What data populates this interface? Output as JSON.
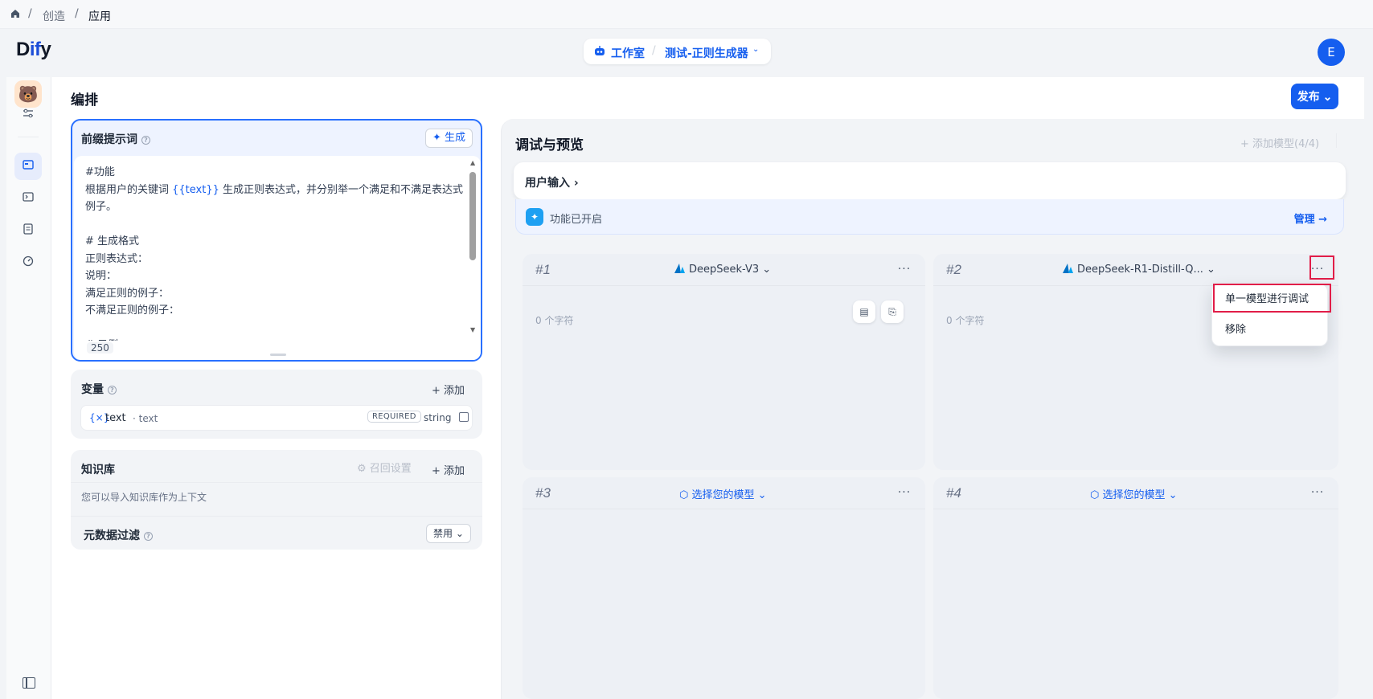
{
  "breadcrumb": {
    "items": [
      "创造",
      "应用"
    ],
    "separator": "/"
  },
  "header": {
    "logo": "Dify",
    "studio_label": "工作室",
    "app_name": "测试-正则生成器",
    "avatar_letter": "E",
    "brand_color": "#155eef"
  },
  "editor": {
    "title": "编排",
    "publish_label": "发布",
    "prompt": {
      "title": "前缀提示词",
      "generate_label": "生成",
      "lines": [
        [
          "#功能"
        ],
        [
          "根据用户的关键词 ",
          "{{text}}",
          " 生成正则表达式，并分别举一个满足和不满足表达式的"
        ],
        [
          "例子。"
        ],
        [
          ""
        ],
        [
          "# 生成格式"
        ],
        [
          "正则表达式："
        ],
        [
          "说明："
        ],
        [
          "满足正则的例子："
        ],
        [
          "不满足正则的例子："
        ],
        [
          ""
        ],
        [
          "# 示例"
        ]
      ],
      "char_count": "250"
    },
    "variables": {
      "title": "变量",
      "add_label": "添加",
      "items": [
        {
          "name": "text",
          "key": "· text",
          "required": "REQUIRED",
          "type": "string"
        }
      ]
    },
    "knowledge": {
      "title": "知识库",
      "recall_label": "召回设置",
      "add_label": "添加",
      "description": "您可以导入知识库作为上下文",
      "metadata_label": "元数据过滤",
      "metadata_value": "禁用"
    }
  },
  "debug": {
    "title": "调试与预览",
    "add_model_label": "添加模型(4/4)",
    "user_input_label": "用户输入",
    "feature_status": "功能已开启",
    "manage_label": "管理",
    "models": [
      {
        "index": "#1",
        "model": "DeepSeek-V3",
        "chars": "0 个字符",
        "chosen": true
      },
      {
        "index": "#2",
        "model": "DeepSeek-R1-Distill-Q...",
        "chars": "0 个字符",
        "chosen": true
      },
      {
        "index": "#3",
        "model": "选择您的模型",
        "chosen": false
      },
      {
        "index": "#4",
        "model": "选择您的模型",
        "chosen": false
      }
    ],
    "menu": {
      "items": [
        "单一模型进行调试",
        "移除"
      ]
    }
  },
  "icons": {
    "home": "home-icon",
    "robot": "robot-icon",
    "more": "more-dots-icon",
    "chevron": "chevron-down-icon"
  }
}
